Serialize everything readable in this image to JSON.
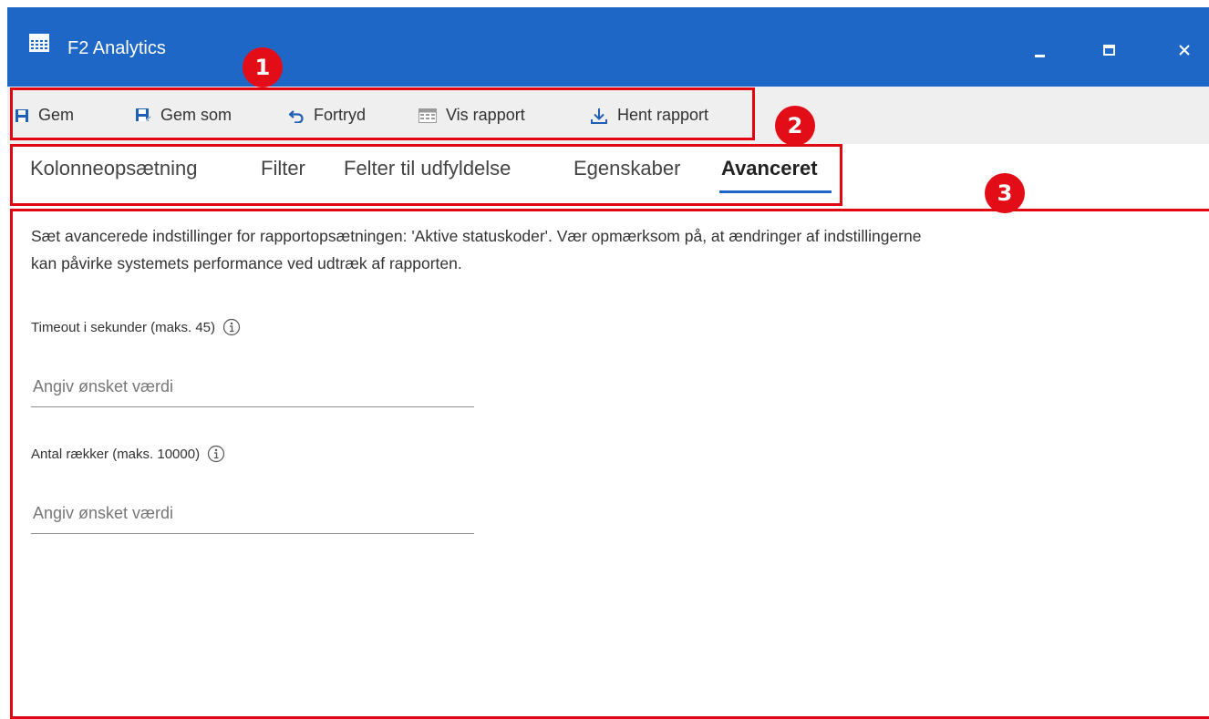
{
  "window": {
    "title": "F2 Analytics"
  },
  "toolbar": {
    "items": [
      {
        "label": "Gem",
        "icon": "floppy-disk-icon"
      },
      {
        "label": "Gem som",
        "icon": "save-as-icon"
      },
      {
        "label": "Fortryd",
        "icon": "undo-icon"
      },
      {
        "label": "Vis rapport",
        "icon": "table-icon"
      },
      {
        "label": "Hent rapport",
        "icon": "download-icon"
      }
    ]
  },
  "tabs": [
    {
      "label": "Kolonneopsætning",
      "active": false
    },
    {
      "label": "Filter",
      "active": false
    },
    {
      "label": "Felter til udfyldelse",
      "active": false
    },
    {
      "label": "Egenskaber",
      "active": false
    },
    {
      "label": "Avanceret",
      "active": true
    }
  ],
  "content": {
    "description_line1": "Sæt avancerede indstillinger for rapportopsætningen: 'Aktive statuskoder'. Vær opmærksom på, at ændringer af indstillingerne",
    "description_line2": "kan påvirke systemets performance ved udtræk af rapporten.",
    "fields": [
      {
        "label": "Timeout i sekunder (maks. 45)",
        "placeholder": "Angiv ønsket værdi",
        "value": ""
      },
      {
        "label": "Antal rækker (maks. 10000)",
        "placeholder": "Angiv ønsket værdi",
        "value": ""
      }
    ]
  },
  "annotations": [
    {
      "number": "1"
    },
    {
      "number": "2"
    },
    {
      "number": "3"
    }
  ],
  "colors": {
    "titlebar": "#1f67c7",
    "toolbar_bg": "#efefef",
    "annotation_red": "#e20613",
    "icon_blue": "#1f5fb4"
  }
}
